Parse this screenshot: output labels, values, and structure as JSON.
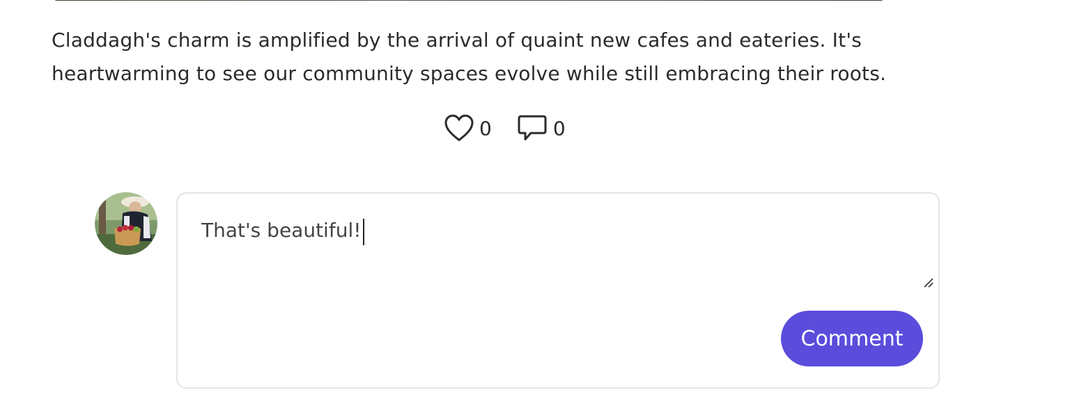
{
  "post": {
    "text": "Claddagh's charm is amplified by the arrival of quaint new cafes and eateries. It's heartwarming to see our community spaces evolve while still embracing their roots."
  },
  "reactions": {
    "likes": {
      "icon": "heart-icon",
      "count": "0"
    },
    "comments": {
      "icon": "speech-bubble-icon",
      "count": "0"
    }
  },
  "comment_form": {
    "avatar_icon": "user-avatar",
    "input_value": "That's beautiful!",
    "submit_label": "Comment"
  },
  "colors": {
    "accent": "#5b4cdc",
    "text": "#2b2b2b",
    "border": "#e4e4e4"
  }
}
